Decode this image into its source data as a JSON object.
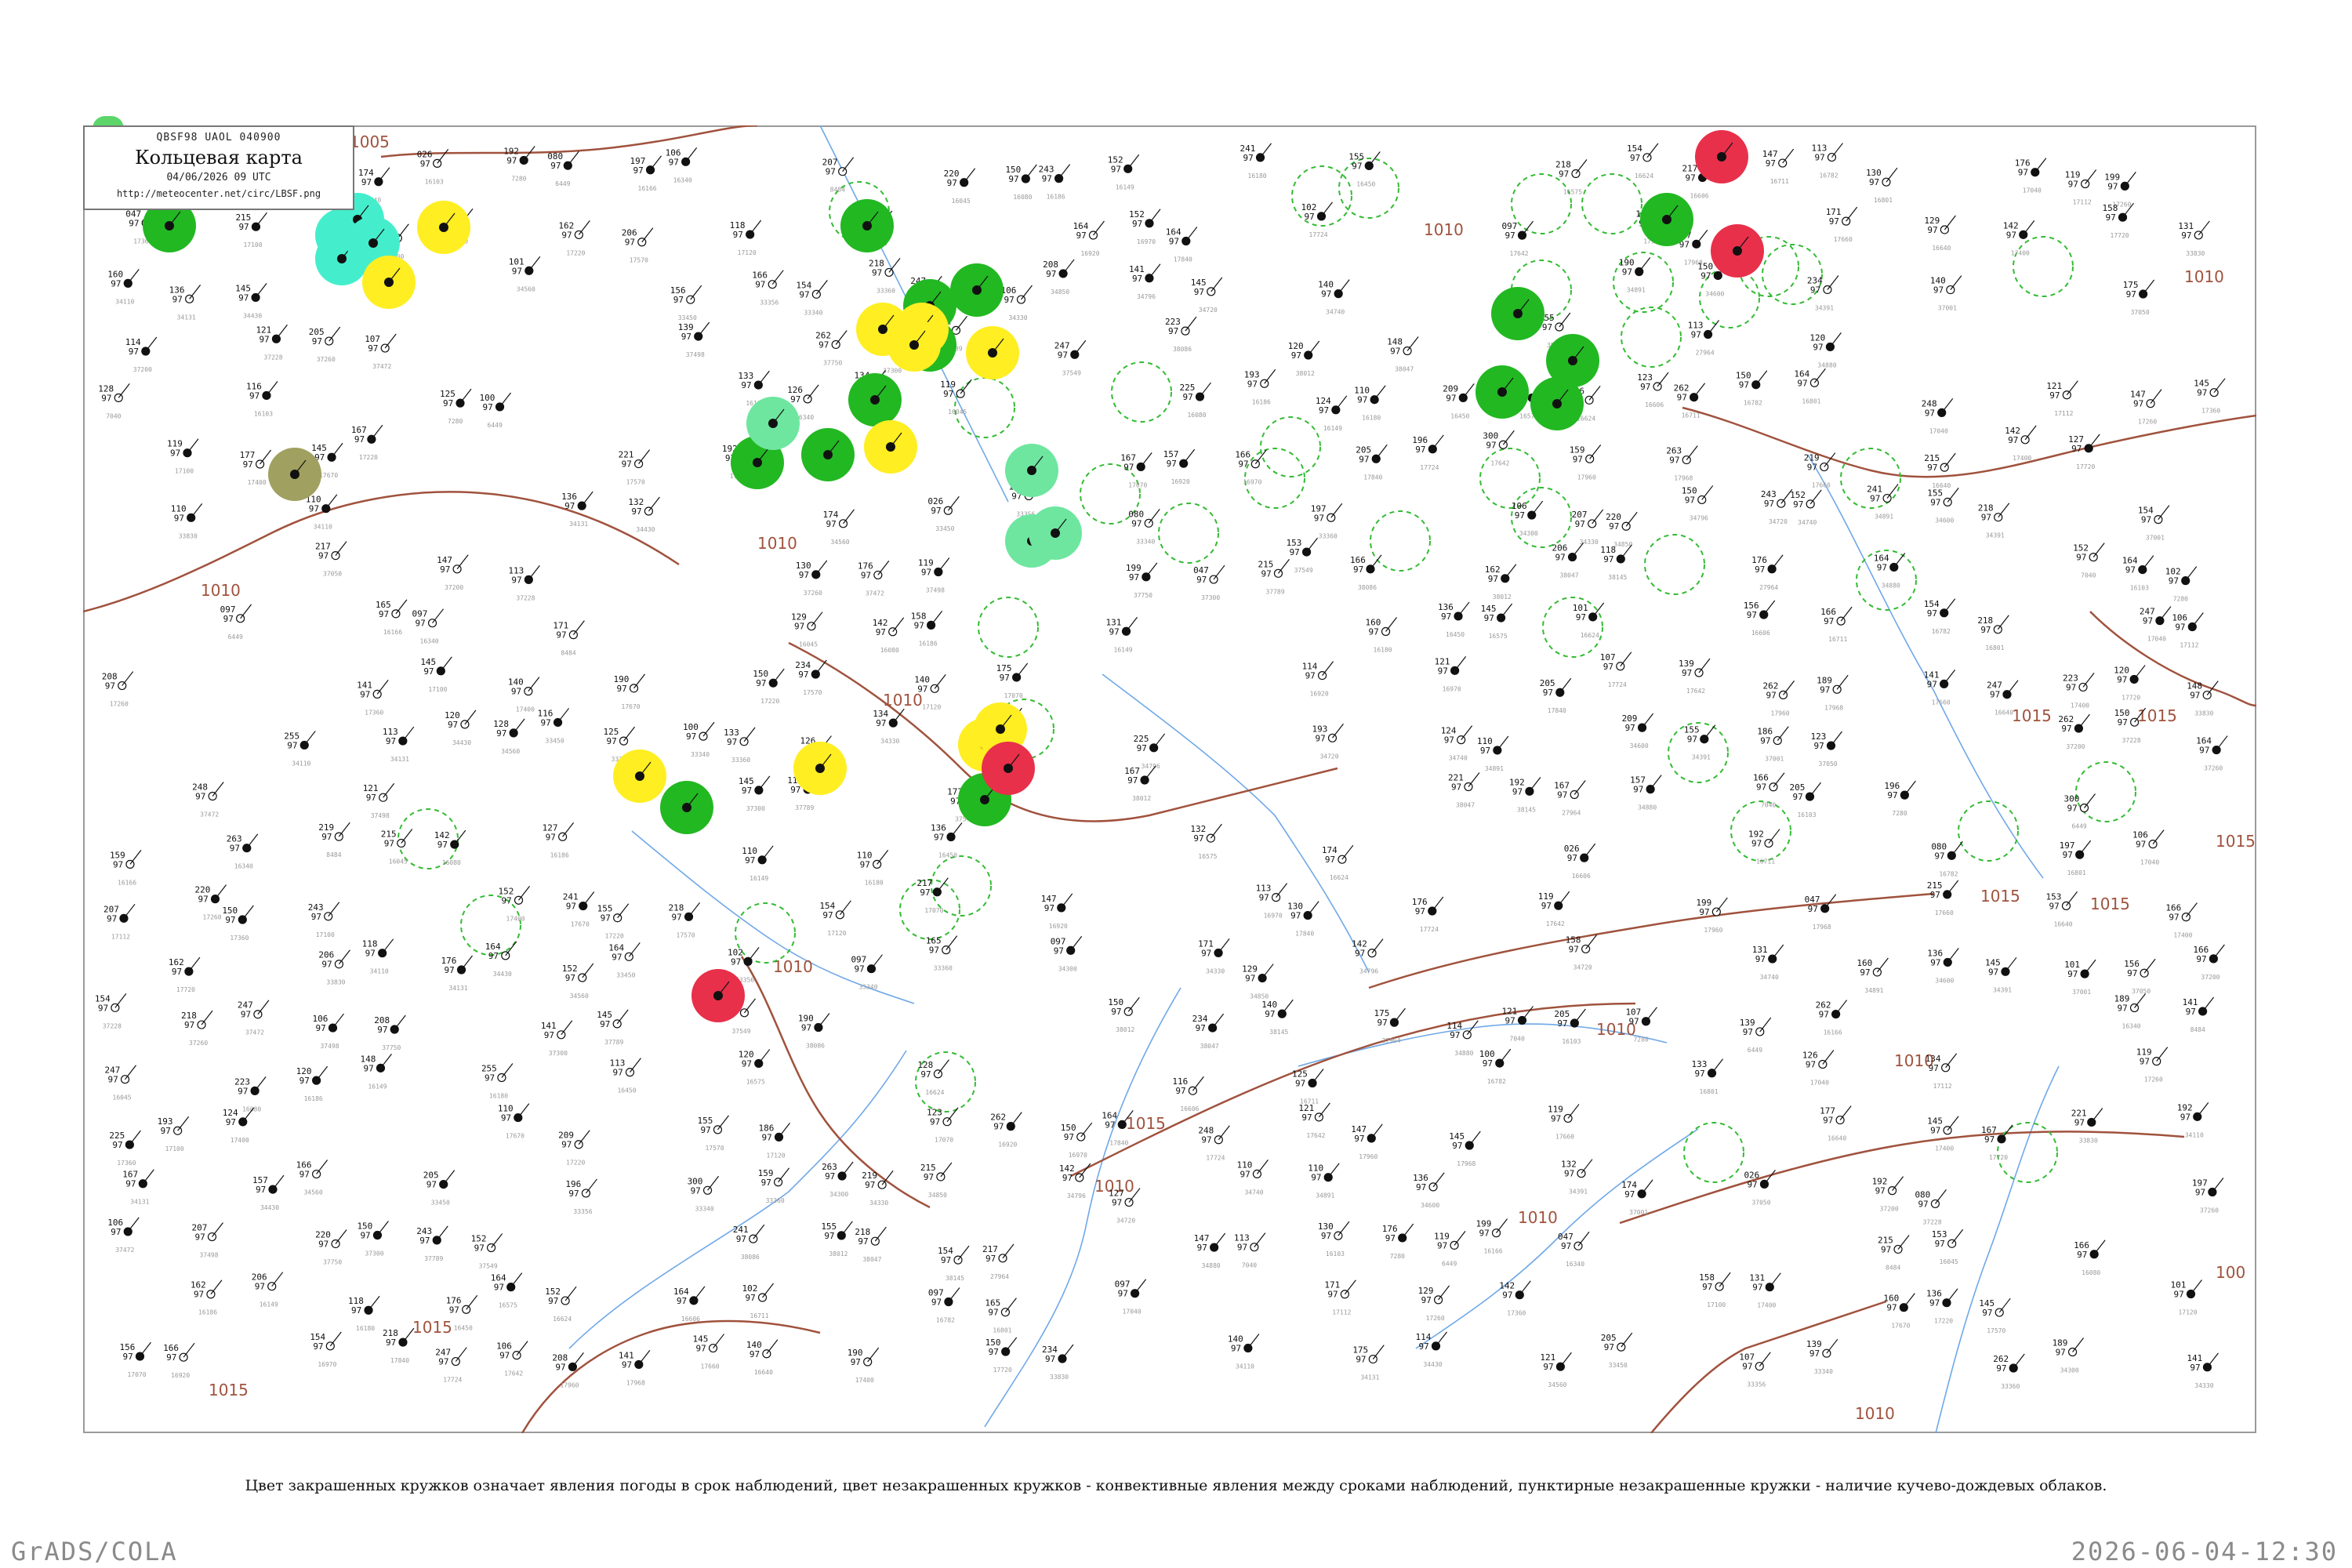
{
  "header": {
    "code_line": "QBSF98  UAOL  040900",
    "title": "Кольцевая карта",
    "datetime": "04/06/2026 09 UTC",
    "url": "http://meteocenter.net/circ/LBSF.png"
  },
  "caption": "Цвет закрашенных кружков означает явления погоды в срок наблюдений, цвет незакрашенных кружков - конвективные явления между сроками наблюдений, пунктирные незакрашенные кружки - наличие кучево-дождевых облаков.",
  "footer": {
    "left": "GrADS/COLA",
    "right": "2026-06-04-12:30"
  },
  "colors": {
    "isobar": "#a0523d",
    "river": "#6fa8e8",
    "rain": "#22b822",
    "shower": "#ffee22",
    "thunder": "#e8304a",
    "drizzle": "#6ee6a0",
    "fog": "#a0a060",
    "snow": "#44eecc",
    "cb_dashed": "#33bb33"
  },
  "isobars": [
    {
      "label": "1005"
    },
    {
      "label": "1010"
    },
    {
      "label": "1015"
    }
  ],
  "isobar_label_instances": [
    "1005",
    "1010",
    "1010",
    "1010",
    "1010",
    "1010",
    "1010",
    "1010",
    "1010",
    "1010",
    "1015",
    "1015",
    "1015",
    "1015",
    "1015",
    "1015",
    "1015",
    "1015",
    "1010",
    "1010",
    "100"
  ],
  "station_numbers": [
    "174",
    "026",
    "192",
    "080",
    "197",
    "106",
    "207",
    "220",
    "150",
    "243",
    "152",
    "241",
    "155",
    "218",
    "154",
    "217",
    "147",
    "113",
    "130",
    "176",
    "119",
    "199",
    "047",
    "215",
    "153",
    "166",
    "162",
    "206",
    "118",
    "176",
    "164",
    "152",
    "164",
    "102",
    "097",
    "165",
    "097",
    "171",
    "129",
    "142",
    "158",
    "131",
    "160",
    "136",
    "145",
    "101",
    "156",
    "166",
    "154",
    "218",
    "247",
    "106",
    "208",
    "141",
    "145",
    "140",
    "190",
    "150",
    "234",
    "140",
    "175",
    "114",
    "121",
    "205",
    "107",
    "139",
    "262",
    "189",
    "141",
    "247",
    "223",
    "120",
    "148",
    "255",
    "113",
    "120",
    "128",
    "116",
    "125",
    "100",
    "133",
    "126",
    "134",
    "119",
    "225",
    "193",
    "124",
    "110",
    "209",
    "155",
    "186",
    "123",
    "262",
    "150",
    "164",
    "248",
    "121",
    "147",
    "145",
    "119",
    "177",
    "145",
    "167",
    "221",
    "192",
    "167",
    "157",
    "166",
    "205",
    "196",
    "300",
    "159",
    "263",
    "219",
    "215",
    "142",
    "127",
    "110",
    "110",
    "136",
    "132"
  ],
  "station_ids": [
    "7040",
    "16103",
    "7280",
    "6449",
    "16166",
    "16340",
    "8484",
    "16045",
    "16080",
    "16186",
    "16149",
    "16180",
    "16450",
    "16575",
    "16624",
    "16606",
    "16711",
    "16782",
    "16801",
    "17040",
    "17112",
    "17260",
    "17360",
    "17100",
    "17400",
    "17670",
    "17220",
    "17570",
    "17120",
    "17070",
    "16920",
    "16970",
    "17840",
    "17724",
    "17642",
    "17960",
    "17968",
    "17660",
    "16640",
    "17400",
    "17720",
    "33830",
    "34110",
    "34131",
    "34430",
    "34560",
    "33450",
    "33356",
    "33340",
    "33360",
    "34300",
    "34330",
    "34850",
    "34796",
    "34720",
    "34740",
    "34891",
    "34600",
    "34391",
    "37001",
    "37050",
    "37200",
    "37228",
    "37260",
    "37472",
    "37498",
    "37750",
    "37300",
    "37789",
    "37549",
    "38086",
    "38012",
    "38047",
    "38145",
    "27964",
    "34880"
  ],
  "weather_stations_filled": [
    {
      "kind": "rain",
      "label": "W1"
    },
    {
      "kind": "snow",
      "label": "W2"
    },
    {
      "kind": "shower",
      "label": "W3"
    },
    {
      "kind": "shower",
      "label": "W4"
    },
    {
      "kind": "fog",
      "label": "W5"
    },
    {
      "kind": "rain",
      "label": "W6"
    },
    {
      "kind": "rain",
      "label": "W7"
    },
    {
      "kind": "shower",
      "label": "W8"
    },
    {
      "kind": "thunder",
      "label": "W9"
    },
    {
      "kind": "drizzle",
      "label": "W10"
    },
    {
      "kind": "thunder",
      "label": "W11"
    }
  ]
}
